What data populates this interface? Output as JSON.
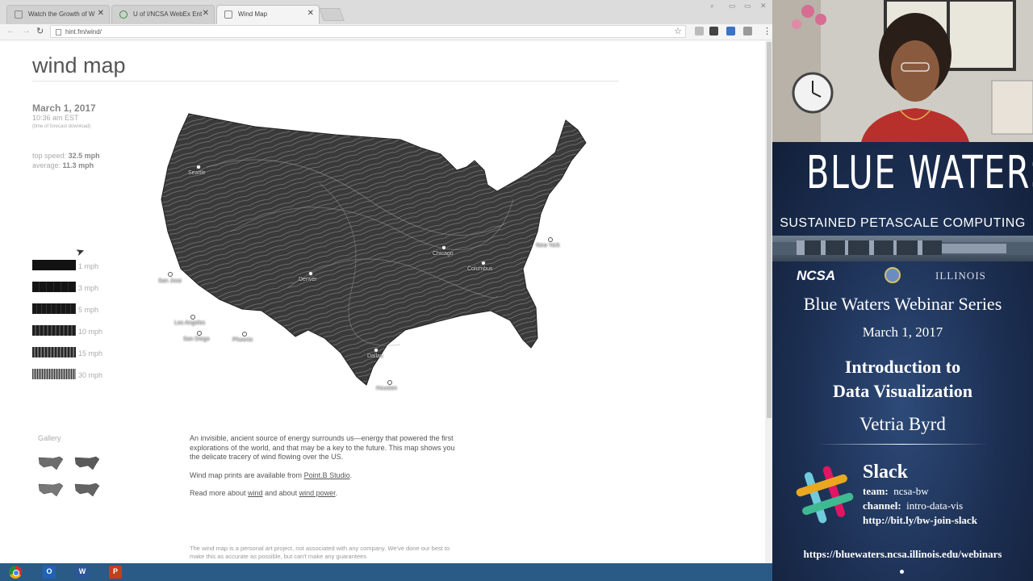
{
  "browser": {
    "tabs": [
      {
        "label": "Watch the Growth of W"
      },
      {
        "label": "U of I/NCSA WebEx Ent"
      },
      {
        "label": "Wind Map"
      }
    ],
    "address": "hint.fm/wind/"
  },
  "page": {
    "title": "wind map",
    "date": "March 1, 2017",
    "time": "10:36 am EST",
    "time_note": "(time of forecast download)",
    "top_speed_label": "top speed:",
    "top_speed": "32.5 mph",
    "average_label": "average:",
    "average": "11.3 mph",
    "legend": [
      "1 mph",
      "3 mph",
      "5 mph",
      "10 mph",
      "15 mph",
      "30 mph"
    ],
    "map_cities": [
      "Seattle",
      "San Jose",
      "Los Angeles",
      "San Diego",
      "Phoenix",
      "Denver",
      "Dallas",
      "Houston",
      "Chicago",
      "Columbus",
      "New York"
    ],
    "gallery_title": "Gallery",
    "description": {
      "p1": "An invisible, ancient source of energy surrounds us—energy that powered the first explorations of the world, and that may be a key to the future. This map shows you the delicate tracery of wind flowing over the US.",
      "p2_prefix": "Wind map prints are available from ",
      "p2_link": "Point.B Studio",
      "p2_suffix": ".",
      "p3_prefix": "Read more about ",
      "p3_link1": "wind",
      "p3_middle": " and about ",
      "p3_link2": "wind power",
      "p3_suffix": "."
    },
    "disclaimer": "The wind map is a personal art project, not associated with any company. We've done our best to make this as accurate as possible, but can't make any guarantees"
  },
  "slide": {
    "brand": "BLUE WATERS",
    "subtitle": "SUSTAINED PETASCALE COMPUTING",
    "ncsa": "NCSA",
    "illinois": "ILLINOIS",
    "series": "Blue Waters Webinar Series",
    "date": "March 1, 2017",
    "talk_line1": "Introduction to",
    "talk_line2": "Data Visualization",
    "speaker": "Vetria Byrd",
    "slack_title": "Slack",
    "team_label": "team:",
    "team": "ncsa-bw",
    "channel_label": "channel:",
    "channel": "intro-data-vis",
    "slack_link": "http://bit.ly/bw-join-slack",
    "url": "https://bluewaters.ncsa.illinois.edu/webinars"
  },
  "colors": {
    "slide_bg": "#1c2f52",
    "taskbar": "#2a5a86",
    "map_fill": "#3a3a3a"
  }
}
